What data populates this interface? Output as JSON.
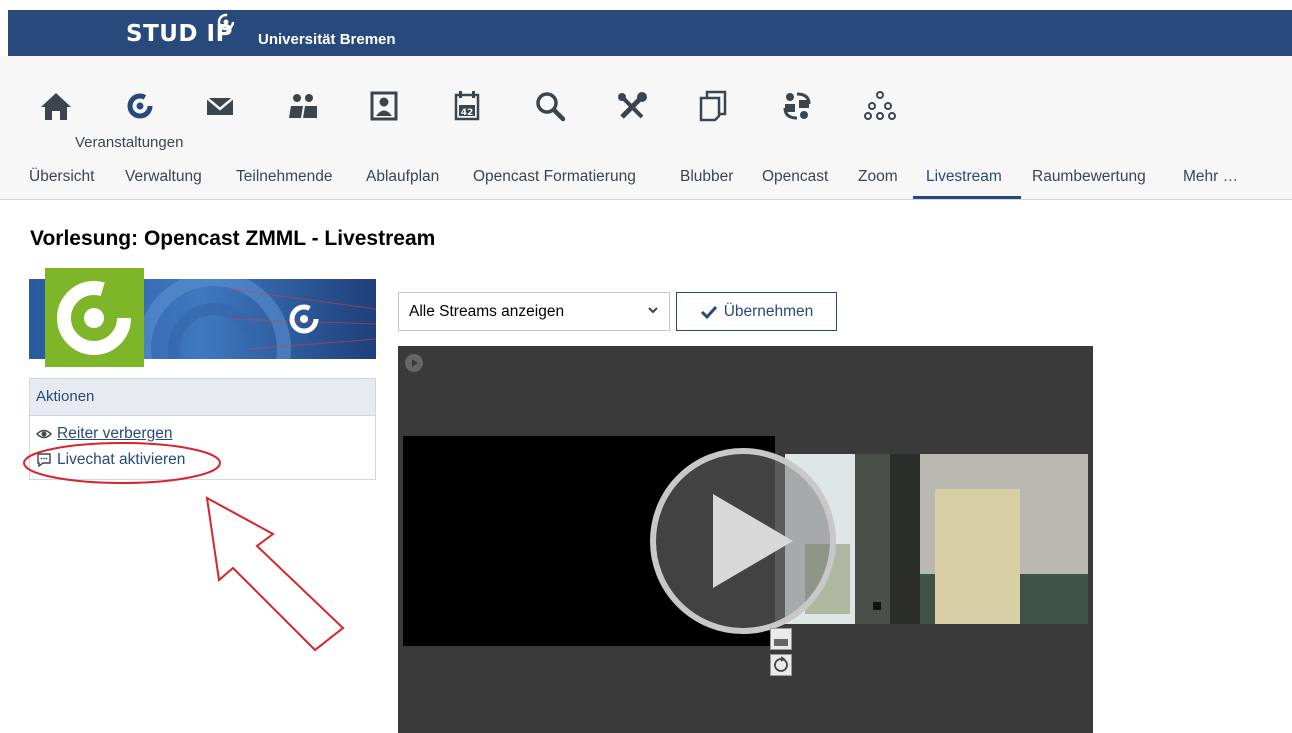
{
  "header": {
    "logo_text": "STUD IP",
    "university": "Universität Bremen"
  },
  "iconbar": {
    "items": [
      {
        "icon": "home-icon"
      },
      {
        "icon": "courses-icon",
        "label": "Veranstaltungen",
        "active": true
      },
      {
        "icon": "mail-icon"
      },
      {
        "icon": "community-icon"
      },
      {
        "icon": "profile-icon"
      },
      {
        "icon": "schedule-icon",
        "date": "42"
      },
      {
        "icon": "search-icon"
      },
      {
        "icon": "tools-icon"
      },
      {
        "icon": "files-icon"
      },
      {
        "icon": "exchange-icon"
      },
      {
        "icon": "hierarchy-icon"
      }
    ]
  },
  "tabs": [
    {
      "label": "Übersicht"
    },
    {
      "label": "Verwaltung"
    },
    {
      "label": "Teilnehmende"
    },
    {
      "label": "Ablaufplan"
    },
    {
      "label": "Opencast Formatierung"
    },
    {
      "label": "Blubber"
    },
    {
      "label": "Opencast"
    },
    {
      "label": "Zoom"
    },
    {
      "label": "Livestream",
      "active": true
    },
    {
      "label": "Raumbewertung"
    },
    {
      "label": "Mehr …"
    }
  ],
  "page": {
    "title": "Vorlesung: Opencast ZMML - Livestream"
  },
  "sidebar": {
    "actions_title": "Aktionen",
    "links": [
      {
        "label": "Reiter verbergen",
        "icon": "eye-icon"
      },
      {
        "label": "Livechat aktivieren",
        "icon": "chat-icon"
      }
    ]
  },
  "controls": {
    "stream_select_value": "Alle Streams anzeigen",
    "apply_label": "Übernehmen"
  },
  "colors": {
    "brand": "#28497c",
    "accent_green": "#7fb529",
    "annotation_red": "#d9242b"
  }
}
